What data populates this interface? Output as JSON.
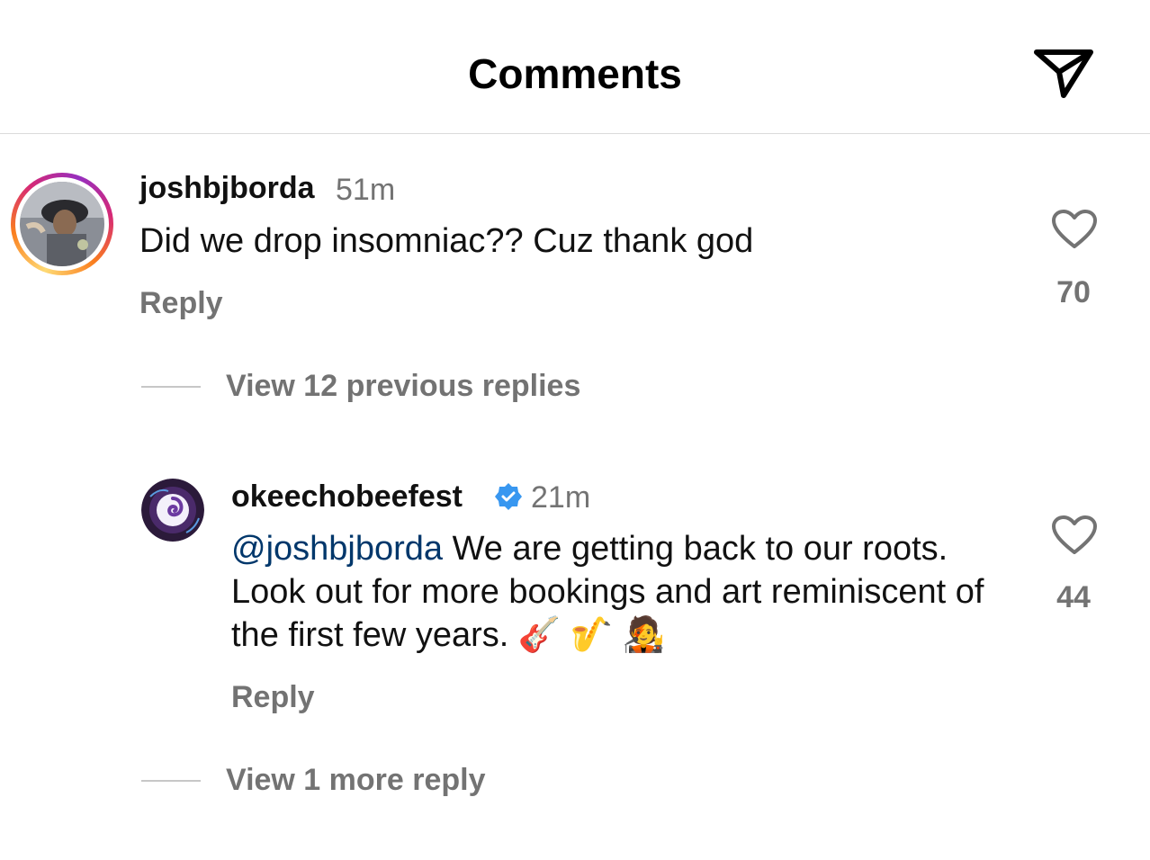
{
  "header": {
    "title": "Comments",
    "share_icon": "paper-plane-icon"
  },
  "comments": [
    {
      "username": "joshbjborda",
      "time": "51m",
      "text": "Did we drop insomniac?? Cuz thank god",
      "reply_label": "Reply",
      "likes": "70",
      "view_replies": "View 12 previous replies"
    }
  ],
  "replies": [
    {
      "username": "okeechobeefest",
      "verified": true,
      "time": "21m",
      "mention": "@joshbjborda",
      "text": " We are getting back to our roots. Look out for more bookings and art reminiscent of the first few years. 🎸 🎷 🧑‍🎤",
      "reply_label": "Reply",
      "likes": "44",
      "view_more": "View 1 more reply"
    }
  ],
  "colors": {
    "muted": "#737373",
    "mention": "#00376b",
    "verified": "#3897f0",
    "divider": "#dbdbdb"
  }
}
